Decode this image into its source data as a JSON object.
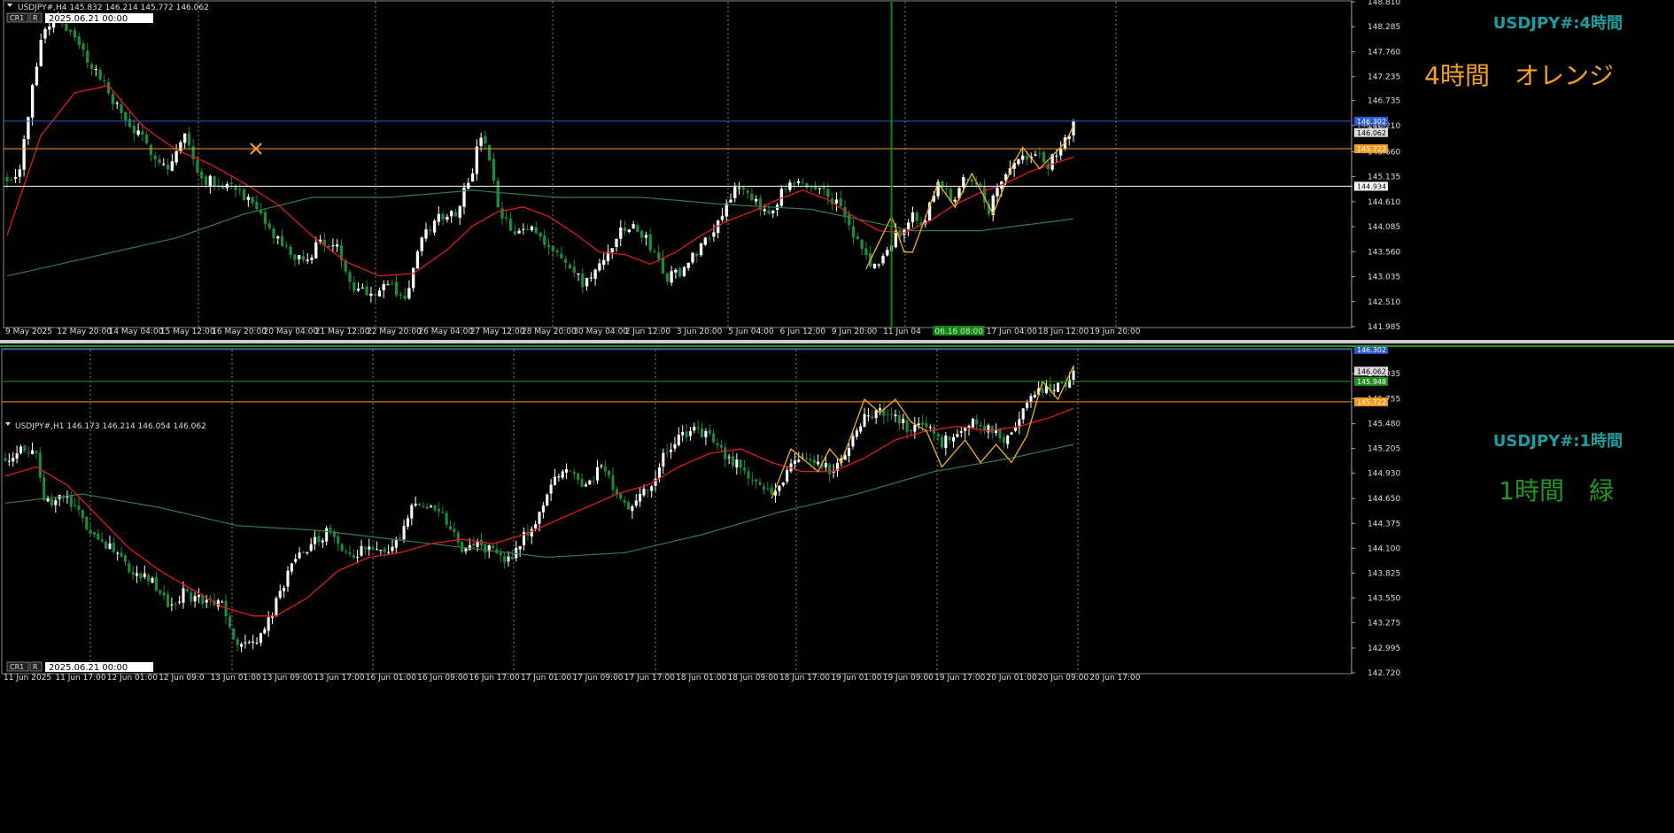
{
  "colors": {
    "background": "#000000",
    "grid": "#bbbbbb",
    "bull": "#ffffff",
    "bear": "#1e8a3c",
    "ma_fast": "#e01b1b",
    "ma_slow": "#2e7d4a",
    "zigzag": "#f0b020",
    "blue_line": "#2a5bd6",
    "orange_line": "#f59a1a",
    "white_line": "#ffffff",
    "green_line": "#1f8f1f",
    "green_vline": "#118811",
    "title_cyan": "#17a0a0",
    "orange_label": "#f5a020",
    "green_label": "#1f9a1f",
    "axis_text": "#dddddd"
  },
  "chart_data": [
    {
      "type": "candlestick",
      "panel": "top",
      "header": "USDJPY#,H4  145.832 146.214 145.772 146.062",
      "top_left_badges": [
        "CR1",
        "R"
      ],
      "top_left_date": "2025.06.21 00:00",
      "symbol_label": "USDJPY#:4時間",
      "color_label": "4時間　オレンジ",
      "ylim": [
        141.985,
        148.81
      ],
      "y_ticks": [
        148.81,
        148.285,
        147.76,
        147.235,
        146.735,
        146.21,
        145.66,
        145.135,
        144.61,
        144.085,
        143.56,
        143.035,
        142.51,
        141.985
      ],
      "y_tick_labels": [
        "148.810",
        "148.285",
        "147.760",
        "147.235",
        "146.735",
        "146.210",
        "145.660",
        "145.135",
        "144.610",
        "144.085",
        "143.560",
        "143.035",
        "142.510",
        "141.985"
      ],
      "x_tick_labels": [
        "9 May 2025",
        "12 May 20:00",
        "14 May 04:00",
        "15 May 12:00",
        "16 May 20:00",
        "20 May 04:00",
        "21 May 12:00",
        "22 May 20:00",
        "26 May 04:00",
        "27 May 12:00",
        "28 May 20:00",
        "30 May 04:00",
        "2 Jun 12:00",
        "3 Jun 20:00",
        "5 Jun 04:00",
        "6 Jun 12:00",
        "9 Jun 20:00",
        "11 Jun 04",
        "06.16 08:00",
        "17 Jun 04:00",
        "18 Jun 12:00",
        "19 Jun 20:00"
      ],
      "x_tick_highlight": "06.16 08:00",
      "hlines": [
        {
          "value": 146.302,
          "label": "146.302",
          "color": "blue_line"
        },
        {
          "value": 145.722,
          "label": "145.722",
          "color": "orange_line"
        },
        {
          "value": 144.934,
          "label": "144.934",
          "color": "white_line"
        }
      ],
      "price_label": {
        "value": 146.062,
        "label": "146.062"
      },
      "overlap_label": "146.219",
      "vline_index": 209,
      "ohlc_close_anchors": [
        [
          0,
          145.1
        ],
        [
          3,
          145.3
        ],
        [
          8,
          148.1
        ],
        [
          12,
          148.55
        ],
        [
          16,
          148.0
        ],
        [
          22,
          147.2
        ],
        [
          28,
          146.3
        ],
        [
          34,
          145.7
        ],
        [
          38,
          145.3
        ],
        [
          42,
          146.0
        ],
        [
          46,
          145.1
        ],
        [
          50,
          145.0
        ],
        [
          54,
          144.95
        ],
        [
          58,
          144.5
        ],
        [
          62,
          144.0
        ],
        [
          66,
          143.6
        ],
        [
          70,
          143.3
        ],
        [
          74,
          143.8
        ],
        [
          78,
          143.6
        ],
        [
          82,
          142.85
        ],
        [
          86,
          142.7
        ],
        [
          90,
          142.9
        ],
        [
          94,
          142.55
        ],
        [
          98,
          143.8
        ],
        [
          102,
          144.3
        ],
        [
          106,
          144.4
        ],
        [
          110,
          145.3
        ],
        [
          112,
          146.0
        ],
        [
          114,
          145.5
        ],
        [
          116,
          144.4
        ],
        [
          120,
          143.9
        ],
        [
          124,
          144.1
        ],
        [
          128,
          143.7
        ],
        [
          132,
          143.3
        ],
        [
          136,
          142.9
        ],
        [
          140,
          143.2
        ],
        [
          144,
          143.9
        ],
        [
          148,
          144.1
        ],
        [
          152,
          143.7
        ],
        [
          156,
          143.0
        ],
        [
          160,
          143.2
        ],
        [
          164,
          143.7
        ],
        [
          168,
          144.2
        ],
        [
          172,
          144.95
        ],
        [
          176,
          144.6
        ],
        [
          180,
          144.4
        ],
        [
          184,
          144.9
        ],
        [
          188,
          144.95
        ],
        [
          192,
          144.9
        ],
        [
          196,
          144.6
        ],
        [
          200,
          143.9
        ],
        [
          204,
          143.3
        ],
        [
          206,
          143.25
        ],
        [
          210,
          143.9
        ],
        [
          214,
          144.3
        ],
        [
          216,
          144.1
        ],
        [
          220,
          145.0
        ],
        [
          224,
          144.6
        ],
        [
          226,
          145.2
        ],
        [
          230,
          145.0
        ],
        [
          232,
          144.4
        ],
        [
          236,
          145.3
        ],
        [
          240,
          145.5
        ],
        [
          244,
          145.6
        ],
        [
          246,
          145.35
        ],
        [
          250,
          145.9
        ],
        [
          252,
          146.2
        ]
      ],
      "ma_fast_anchors": [
        [
          0,
          143.9
        ],
        [
          8,
          146.0
        ],
        [
          16,
          146.9
        ],
        [
          24,
          147.05
        ],
        [
          32,
          146.2
        ],
        [
          40,
          145.7
        ],
        [
          48,
          145.4
        ],
        [
          56,
          145.0
        ],
        [
          64,
          144.55
        ],
        [
          72,
          143.9
        ],
        [
          80,
          143.35
        ],
        [
          88,
          143.05
        ],
        [
          96,
          143.1
        ],
        [
          104,
          143.6
        ],
        [
          110,
          144.1
        ],
        [
          116,
          144.4
        ],
        [
          122,
          144.5
        ],
        [
          128,
          144.3
        ],
        [
          134,
          143.95
        ],
        [
          140,
          143.55
        ],
        [
          146,
          143.5
        ],
        [
          152,
          143.3
        ],
        [
          158,
          143.55
        ],
        [
          164,
          143.9
        ],
        [
          170,
          144.2
        ],
        [
          176,
          144.4
        ],
        [
          182,
          144.65
        ],
        [
          188,
          144.85
        ],
        [
          194,
          144.65
        ],
        [
          200,
          144.3
        ],
        [
          206,
          144.0
        ],
        [
          212,
          143.95
        ],
        [
          218,
          144.2
        ],
        [
          224,
          144.55
        ],
        [
          230,
          144.8
        ],
        [
          236,
          145.0
        ],
        [
          242,
          145.25
        ],
        [
          252,
          145.55
        ]
      ],
      "ma_slow_anchors": [
        [
          0,
          143.05
        ],
        [
          20,
          143.45
        ],
        [
          40,
          143.85
        ],
        [
          56,
          144.35
        ],
        [
          72,
          144.7
        ],
        [
          90,
          144.7
        ],
        [
          110,
          144.85
        ],
        [
          130,
          144.7
        ],
        [
          150,
          144.7
        ],
        [
          170,
          144.55
        ],
        [
          190,
          144.45
        ],
        [
          206,
          144.15
        ],
        [
          214,
          144.0
        ],
        [
          230,
          144.0
        ],
        [
          252,
          144.25
        ]
      ],
      "zigzag": [
        [
          203,
          143.2
        ],
        [
          209,
          144.3
        ],
        [
          212,
          143.55
        ],
        [
          214,
          143.55
        ],
        [
          220,
          145.0
        ],
        [
          224,
          144.5
        ],
        [
          228,
          145.2
        ],
        [
          233,
          144.35
        ],
        [
          238,
          145.45
        ],
        [
          240,
          145.75
        ],
        [
          244,
          145.3
        ],
        [
          250,
          145.85
        ],
        [
          252,
          146.2
        ]
      ],
      "n_bars": 253,
      "seed": 7
    },
    {
      "type": "candlestick",
      "panel": "bottom",
      "header": "USDJPY#,H1  146.173 146.214 146.054 146.062",
      "top_left_badges": [
        "CR1",
        "R"
      ],
      "top_left_date": "2025.06.21 00:00",
      "symbol_label": "USDJPY#:1時間",
      "color_label": "1時間　緑",
      "ylim": [
        142.72,
        146.3
      ],
      "y_ticks": [
        146.035,
        145.755,
        145.48,
        145.205,
        144.93,
        144.65,
        144.375,
        144.1,
        143.825,
        143.55,
        143.275,
        142.995,
        142.72
      ],
      "y_tick_labels": [
        "146.035",
        "145.755",
        "145.480",
        "145.205",
        "144.930",
        "144.650",
        "144.375",
        "144.100",
        "143.825",
        "143.550",
        "143.275",
        "142.995",
        "142.720"
      ],
      "x_tick_labels": [
        "11 Jun 2025",
        "11 Jun 17:00",
        "12 Jun 01:00",
        "12 Jun 09:0",
        "13 Jun 01:00",
        "13 Jun 09:00",
        "13 Jun 17:00",
        "16 Jun 01:00",
        "16 Jun 09:00",
        "16 Jun 17:00",
        "17 Jun 01:00",
        "17 Jun 09:00",
        "17 Jun 17:00",
        "18 Jun 01:00",
        "18 Jun 09:00",
        "18 Jun 17:00",
        "19 Jun 01:00",
        "19 Jun 09:00",
        "19 Jun 17:00",
        "20 Jun 01:00",
        "20 Jun 09:00",
        "20 Jun 17:00"
      ],
      "hlines": [
        {
          "value": 146.302,
          "label": "146.302",
          "color": "blue_line"
        },
        {
          "value": 145.948,
          "label": "145.948",
          "color": "green_line"
        },
        {
          "value": 145.722,
          "label": "145.722",
          "color": "orange_line"
        }
      ],
      "price_label": {
        "value": 146.062,
        "label": "146.062"
      },
      "ohlc_close_anchors": [
        [
          0,
          145.1
        ],
        [
          4,
          145.2
        ],
        [
          8,
          145.1
        ],
        [
          10,
          144.6
        ],
        [
          16,
          144.65
        ],
        [
          20,
          144.4
        ],
        [
          26,
          144.15
        ],
        [
          32,
          143.85
        ],
        [
          38,
          143.75
        ],
        [
          42,
          143.45
        ],
        [
          46,
          143.6
        ],
        [
          52,
          143.5
        ],
        [
          56,
          143.45
        ],
        [
          60,
          143.0
        ],
        [
          66,
          143.1
        ],
        [
          70,
          143.5
        ],
        [
          74,
          143.9
        ],
        [
          78,
          144.1
        ],
        [
          84,
          144.3
        ],
        [
          88,
          144.0
        ],
        [
          94,
          144.1
        ],
        [
          98,
          144.0
        ],
        [
          102,
          144.25
        ],
        [
          106,
          144.65
        ],
        [
          110,
          144.55
        ],
        [
          114,
          144.4
        ],
        [
          118,
          144.1
        ],
        [
          122,
          144.15
        ],
        [
          126,
          144.05
        ],
        [
          130,
          143.95
        ],
        [
          134,
          144.25
        ],
        [
          138,
          144.45
        ],
        [
          142,
          144.9
        ],
        [
          146,
          144.95
        ],
        [
          150,
          144.8
        ],
        [
          154,
          145.0
        ],
        [
          158,
          144.7
        ],
        [
          162,
          144.55
        ],
        [
          166,
          144.75
        ],
        [
          170,
          145.1
        ],
        [
          174,
          145.35
        ],
        [
          178,
          145.4
        ],
        [
          182,
          145.35
        ],
        [
          186,
          145.1
        ],
        [
          190,
          145.0
        ],
        [
          194,
          144.85
        ],
        [
          198,
          144.7
        ],
        [
          202,
          144.95
        ],
        [
          206,
          145.15
        ],
        [
          210,
          145.05
        ],
        [
          214,
          144.95
        ],
        [
          218,
          145.2
        ],
        [
          222,
          145.55
        ],
        [
          226,
          145.6
        ],
        [
          230,
          145.55
        ],
        [
          234,
          145.4
        ],
        [
          238,
          145.5
        ],
        [
          242,
          145.25
        ],
        [
          246,
          145.4
        ],
        [
          250,
          145.5
        ],
        [
          254,
          145.45
        ],
        [
          258,
          145.25
        ],
        [
          262,
          145.55
        ],
        [
          266,
          145.85
        ],
        [
          270,
          145.85
        ],
        [
          274,
          145.9
        ],
        [
          276,
          146.1
        ]
      ],
      "ma_fast_anchors": [
        [
          0,
          144.9
        ],
        [
          8,
          145.0
        ],
        [
          16,
          144.8
        ],
        [
          24,
          144.45
        ],
        [
          32,
          144.1
        ],
        [
          40,
          143.85
        ],
        [
          48,
          143.65
        ],
        [
          56,
          143.45
        ],
        [
          64,
          143.35
        ],
        [
          70,
          143.35
        ],
        [
          78,
          143.55
        ],
        [
          86,
          143.85
        ],
        [
          94,
          144.0
        ],
        [
          102,
          144.05
        ],
        [
          110,
          144.15
        ],
        [
          118,
          144.2
        ],
        [
          126,
          144.15
        ],
        [
          134,
          144.25
        ],
        [
          142,
          144.4
        ],
        [
          150,
          144.55
        ],
        [
          158,
          144.7
        ],
        [
          166,
          144.8
        ],
        [
          174,
          145.0
        ],
        [
          182,
          145.15
        ],
        [
          190,
          145.2
        ],
        [
          198,
          145.05
        ],
        [
          206,
          144.95
        ],
        [
          214,
          144.95
        ],
        [
          222,
          145.1
        ],
        [
          230,
          145.3
        ],
        [
          238,
          145.4
        ],
        [
          246,
          145.45
        ],
        [
          254,
          145.4
        ],
        [
          262,
          145.45
        ],
        [
          270,
          145.55
        ],
        [
          276,
          145.65
        ]
      ],
      "ma_slow_anchors": [
        [
          0,
          144.6
        ],
        [
          20,
          144.7
        ],
        [
          40,
          144.55
        ],
        [
          60,
          144.35
        ],
        [
          80,
          144.3
        ],
        [
          100,
          144.2
        ],
        [
          120,
          144.1
        ],
        [
          140,
          144.0
        ],
        [
          160,
          144.05
        ],
        [
          180,
          144.25
        ],
        [
          200,
          144.5
        ],
        [
          220,
          144.7
        ],
        [
          240,
          144.95
        ],
        [
          260,
          145.1
        ],
        [
          276,
          145.25
        ]
      ],
      "zigzag": [
        [
          198,
          144.65
        ],
        [
          203,
          145.2
        ],
        [
          210,
          144.95
        ],
        [
          213,
          145.2
        ],
        [
          216,
          145.05
        ],
        [
          222,
          145.75
        ],
        [
          226,
          145.6
        ],
        [
          230,
          145.75
        ],
        [
          234,
          145.5
        ],
        [
          238,
          145.4
        ],
        [
          242,
          145.0
        ],
        [
          248,
          145.3
        ],
        [
          252,
          145.05
        ],
        [
          256,
          145.25
        ],
        [
          260,
          145.05
        ],
        [
          264,
          145.35
        ],
        [
          268,
          145.95
        ],
        [
          272,
          145.75
        ],
        [
          276,
          146.12
        ]
      ],
      "n_bars": 277,
      "seed": 13
    }
  ]
}
